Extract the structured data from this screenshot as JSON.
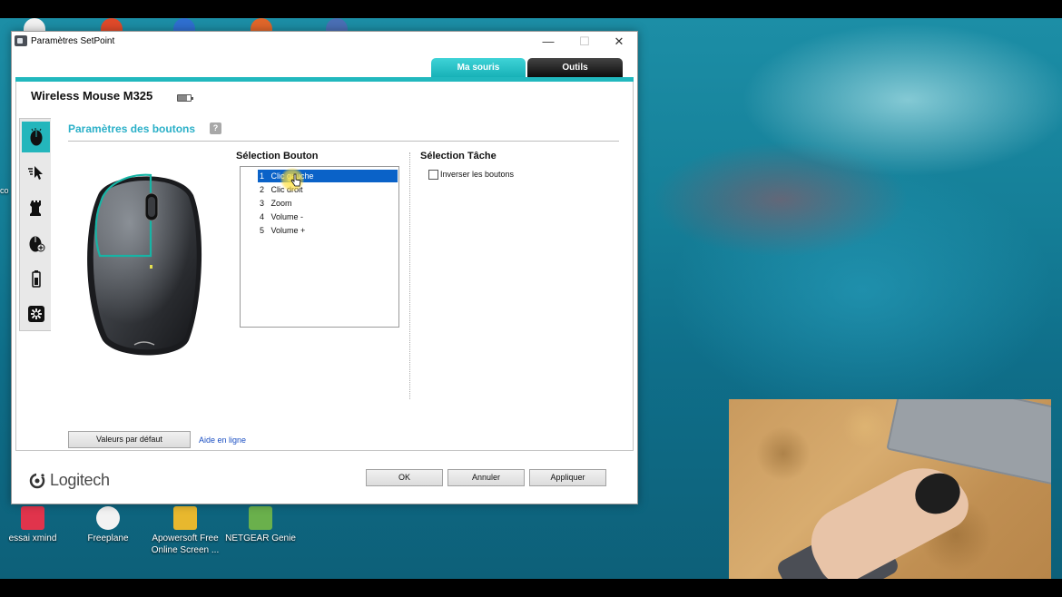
{
  "window": {
    "title": "Paramètres SetPoint",
    "minimize": "—",
    "maximize": "☐",
    "close": "✕"
  },
  "tabs": [
    {
      "label": "Ma souris",
      "active": true
    },
    {
      "label": "Outils",
      "active": false
    }
  ],
  "device": {
    "name": "Wireless Mouse M325",
    "battery_icon": "battery-icon"
  },
  "sidebar": {
    "items": [
      {
        "icon": "mouse-icon",
        "active": true
      },
      {
        "icon": "pointer-speed-icon",
        "active": false
      },
      {
        "icon": "game-piece-icon",
        "active": false
      },
      {
        "icon": "mouse-plus-icon",
        "active": false
      },
      {
        "icon": "battery-status-icon",
        "active": false
      },
      {
        "icon": "gear-icon",
        "active": false
      }
    ]
  },
  "section": {
    "title": "Paramètres des boutons",
    "help": "?"
  },
  "button_selection": {
    "header": "Sélection Bouton",
    "items": [
      {
        "num": "1",
        "label": "Clic gauche",
        "selected": true
      },
      {
        "num": "2",
        "label": "Clic droit",
        "selected": false
      },
      {
        "num": "3",
        "label": "Zoom",
        "selected": false
      },
      {
        "num": "4",
        "label": "Volume -",
        "selected": false
      },
      {
        "num": "5",
        "label": "Volume +",
        "selected": false
      }
    ]
  },
  "task_selection": {
    "header": "Sélection Tâche",
    "option_label": "Inverser les boutons",
    "option_checked": false
  },
  "footer": {
    "defaults_button": "Valeurs par défaut",
    "help_link": "Aide en ligne",
    "ok_button": "OK",
    "cancel_button": "Annuler",
    "apply_button": "Appliquer",
    "brand": "Logitech"
  },
  "desktop": {
    "icons": [
      {
        "label": "essai xmind"
      },
      {
        "label": "Freeplane"
      },
      {
        "label": "Apowersoft Free Online Screen ..."
      },
      {
        "label": "NETGEAR Genie"
      }
    ],
    "partial_label": "co"
  },
  "colors": {
    "accent": "#21b8be",
    "selection": "#0a62c8",
    "title_blue": "#2bb0c8",
    "link": "#1b4fc3"
  }
}
